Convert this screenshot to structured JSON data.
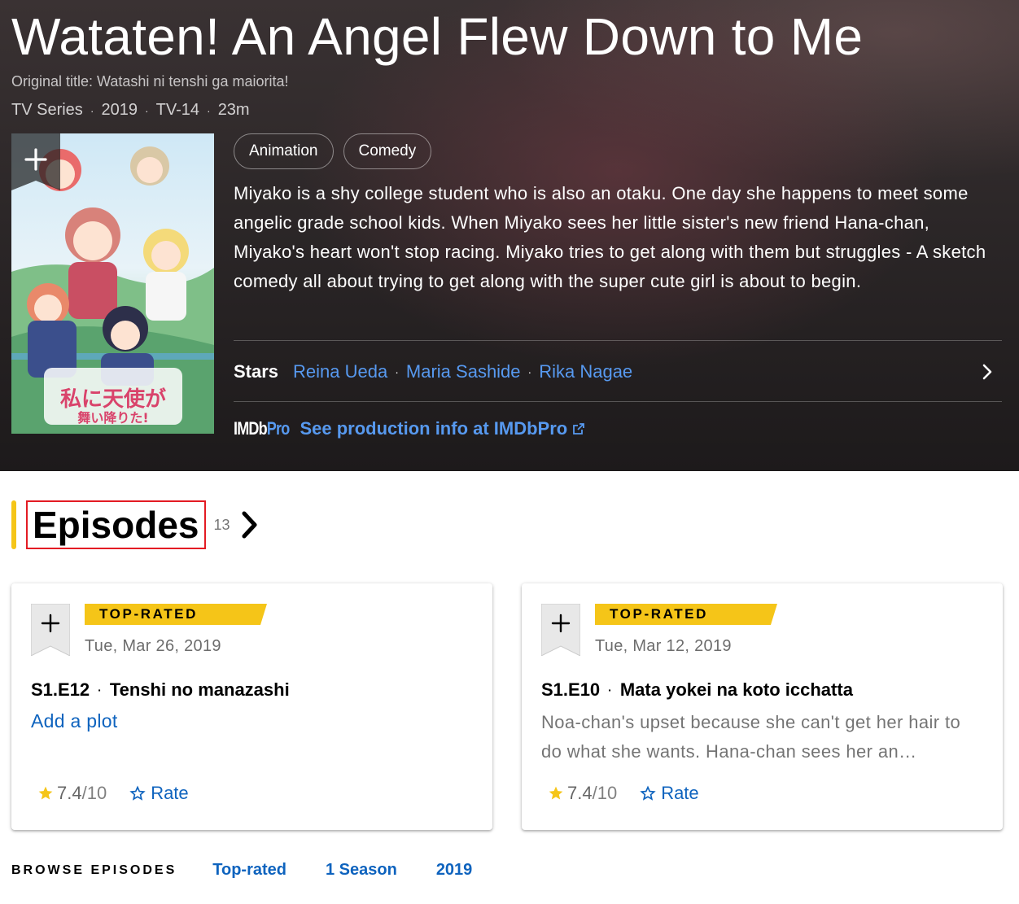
{
  "hero": {
    "title": "Wataten! An Angel Flew Down to Me",
    "original_title": "Original title: Watashi ni tenshi ga maiorita!",
    "meta": [
      "TV Series",
      "2019",
      "TV-14",
      "23m"
    ],
    "genres": [
      "Animation",
      "Comedy"
    ],
    "plot": "Miyako is a shy college student who is also an otaku. One day she happens to meet some angelic grade school kids. When Miyako sees her little sister's new friend Hana-chan, Miyako's heart won't stop racing. Miyako tries to get along with them but struggles - A sketch comedy all about trying to get along with the super cute girl is about to begin.",
    "stars_label": "Stars",
    "stars": [
      "Reina Ueda",
      "Maria Sashide",
      "Rika Nagae"
    ],
    "imdbpro_logo_a": "IMDb",
    "imdbpro_logo_b": "Pro",
    "imdbpro_link": "See production info at IMDbPro",
    "poster_logo_text": "私に天使が舞い降りた!"
  },
  "episodes": {
    "title": "Episodes",
    "count": "13",
    "cards": [
      {
        "badge": "TOP-RATED",
        "date": "Tue, Mar 26, 2019",
        "code": "S1.E12",
        "name": "Tenshi no manazashi",
        "plot": "Add a plot",
        "rating": "7.4",
        "rating_out": "/10",
        "rate_label": "Rate"
      },
      {
        "badge": "TOP-RATED",
        "date": "Tue, Mar 12, 2019",
        "code": "S1.E10",
        "name": "Mata yokei na koto icchatta",
        "plot": "Noa-chan's upset because she can't get her hair to do what she wants. Hana-chan sees her an…",
        "rating": "7.4",
        "rating_out": "/10",
        "rate_label": "Rate"
      }
    ]
  },
  "browse": {
    "label": "BROWSE EPISODES",
    "links": [
      "Top-rated",
      "1 Season",
      "2019"
    ]
  },
  "colors": {
    "accent_yellow": "#f5c518",
    "link_blue_dark": "#5799ef",
    "link_blue_light": "#0e63be"
  }
}
